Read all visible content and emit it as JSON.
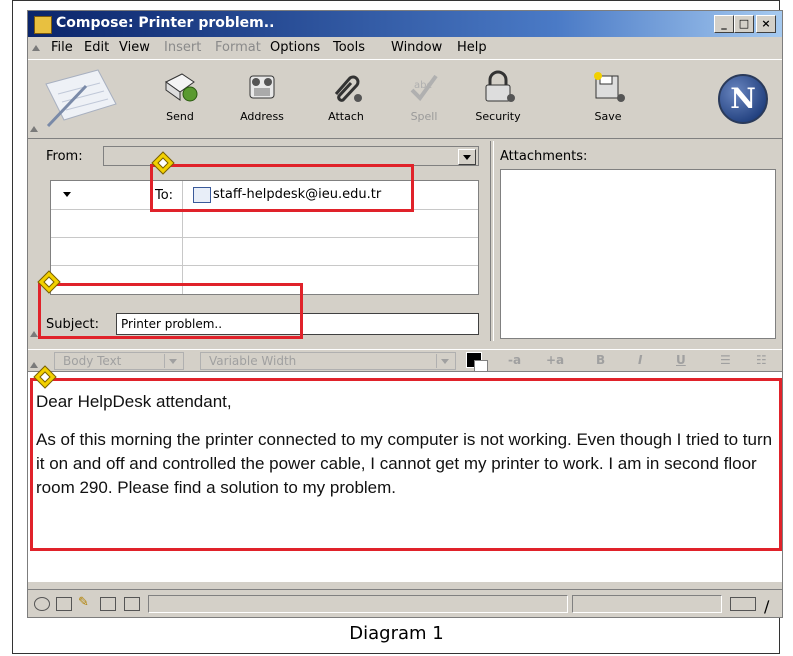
{
  "window": {
    "title": "Compose: Printer problem..",
    "controls": {
      "minimize": "_",
      "maximize": "□",
      "close": "×"
    }
  },
  "menu": [
    {
      "label": "File",
      "enabled": true
    },
    {
      "label": "Edit",
      "enabled": true
    },
    {
      "label": "View",
      "enabled": true
    },
    {
      "label": "Insert",
      "enabled": false
    },
    {
      "label": "Format",
      "enabled": false
    },
    {
      "label": "Options",
      "enabled": true
    },
    {
      "label": "Tools",
      "enabled": true
    },
    {
      "label": "Window",
      "enabled": true
    },
    {
      "label": "Help",
      "enabled": true
    }
  ],
  "toolbar": {
    "send": "Send",
    "address": "Address",
    "attach": "Attach",
    "spell": "Spell",
    "security": "Security",
    "save": "Save",
    "logo": "N"
  },
  "header": {
    "from_label": "From:",
    "from_value": "",
    "to_label": "To:",
    "to_value": "staff-helpdesk@ieu.edu.tr",
    "subject_label": "Subject:",
    "subject_value": "Printer problem..",
    "attachments_label": "Attachments:"
  },
  "format_bar": {
    "paragraph_style": "Body Text",
    "font": "Variable Width",
    "smaller": "-a",
    "larger": "+a",
    "bold": "B",
    "italic": "I",
    "underline": "U",
    "bullets": "☰",
    "numbers": "☷"
  },
  "body": {
    "greeting": "Dear HelpDesk attendant,",
    "message": "As of this morning the printer connected to my computer is not working. Even though I tried to turn it on and off and controlled the power cable, I cannot get my printer to work. I am in second floor room 290. Please find a solution to my problem."
  },
  "caption": "Diagram 1",
  "colors": {
    "title_bar": "#0a246a",
    "chrome": "#d4d0c8",
    "highlight_box": "#e0222a",
    "marker": "#f2d000"
  }
}
